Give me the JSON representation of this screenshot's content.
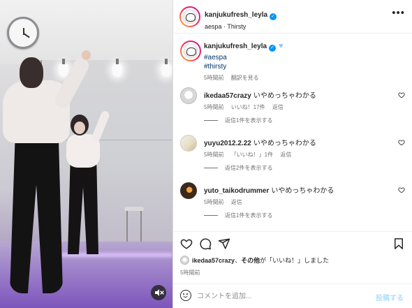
{
  "post": {
    "username": "kanjukufresh_leyla",
    "audio": "aespa · Thirsty"
  },
  "caption": {
    "username": "kanjukufresh_leyla",
    "hashtags": [
      "#aespa",
      "#thirsty"
    ],
    "time": "5時間前",
    "translate": "翻訳を見る"
  },
  "comments": [
    {
      "username": "ikedaa57crazy",
      "text": "いやめっちゃわかる",
      "time": "5時間前",
      "likes": "いいね！17件",
      "reply": "返信",
      "replies": "返信1件を表示する"
    },
    {
      "username": "yuyu2012.2.22",
      "text": "いやめっちゃわかる",
      "time": "5時間前",
      "likes": "「いいね！」1件",
      "reply": "返信",
      "replies": "返信2件を表示する"
    },
    {
      "username": "yuto_taikodrummer",
      "text": "いやめっちゃわかる",
      "time": "5時間前",
      "likes": "",
      "reply": "返信",
      "replies": "返信1件を表示する"
    }
  ],
  "liked_by": {
    "user": "ikedaa57crazy",
    "sep": "、",
    "others": "その他",
    "suffix": "が「いいね！」しました"
  },
  "footer": {
    "time": "5時間前",
    "comment_placeholder": "コメントを追加...",
    "post_label": "投稿する"
  },
  "icons": {
    "more": "more-horizontal-icon",
    "heart": "heart-icon",
    "comment": "comment-icon",
    "share": "share-icon",
    "save": "bookmark-icon",
    "mute": "muted-speaker-icon",
    "emoji": "emoji-icon"
  },
  "colors": {
    "verified": "#0095f6",
    "link": "#00376b",
    "muted_text": "#737373",
    "post_button_disabled": "#b2dffc"
  }
}
